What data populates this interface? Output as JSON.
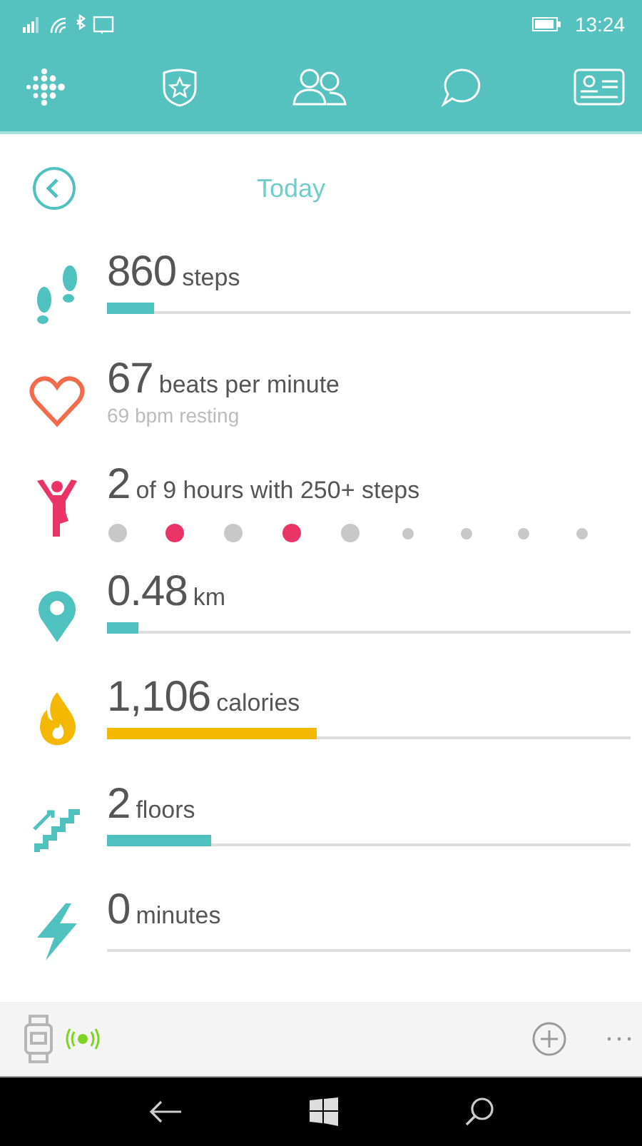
{
  "status_bar": {
    "time": "13:24"
  },
  "header": {
    "title": "Today"
  },
  "rows": [
    {
      "kind": "bar",
      "value": "860",
      "unit": "steps",
      "color": "#4fc1be",
      "level": 0.09
    },
    {
      "kind": "sub",
      "value": "67",
      "unit": "beats per minute",
      "subtitle": "69 bpm resting",
      "color": "#f26b4a"
    },
    {
      "kind": "dots",
      "value": "2",
      "unit": "of 9 hours with 250+ steps",
      "color": "#ea3468",
      "dots": [
        {
          "met": false,
          "past": true
        },
        {
          "met": true,
          "past": true
        },
        {
          "met": false,
          "past": true
        },
        {
          "met": true,
          "past": true
        },
        {
          "met": false,
          "past": true
        },
        {
          "met": false,
          "past": false
        },
        {
          "met": false,
          "past": false
        },
        {
          "met": false,
          "past": false
        },
        {
          "met": false,
          "past": false
        }
      ]
    },
    {
      "kind": "bar",
      "value": "0.48",
      "unit": "km",
      "color": "#4fc1be",
      "level": 0.06
    },
    {
      "kind": "bar",
      "value": "1,106",
      "unit": "calories",
      "color": "#f5b800",
      "level": 0.4
    },
    {
      "kind": "bar",
      "value": "2",
      "unit": "floors",
      "color": "#4fc1be",
      "level": 0.2
    },
    {
      "kind": "bar",
      "value": "0",
      "unit": "minutes",
      "color": "#4fc1be"
    }
  ]
}
